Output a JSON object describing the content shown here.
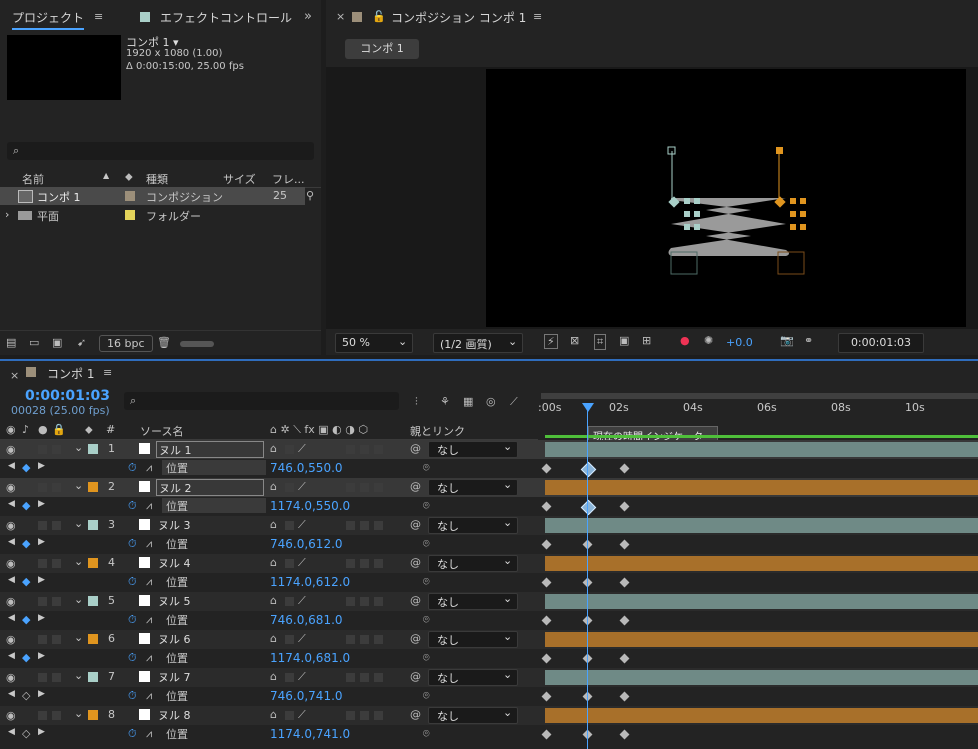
{
  "project_panel": {
    "tab_project": "プロジェクト",
    "tab_effect": "エフェクトコントロール",
    "comp_name": "コンポ 1 ▾",
    "comp_size": "1920 x 1080 (1.00)",
    "comp_duration": "Δ 0:00:15:00, 25.00 fps",
    "search_placeholder": "",
    "columns": [
      "名前",
      "種類",
      "サイズ",
      "フレ..."
    ],
    "items": [
      {
        "name": "コンポ 1",
        "type": "コンポジション",
        "size": "",
        "frames": "25",
        "color": "#9c8f7a"
      },
      {
        "name": "平面",
        "type": "フォルダー",
        "size": "",
        "frames": "",
        "color": "#e3d35a"
      }
    ],
    "bpc": "16 bpc"
  },
  "comp_panel": {
    "title": "コンポジション コンポ 1",
    "tab_label": "コンポ 1",
    "zoom": "50 %",
    "resolution": "(1/2 画質)",
    "exposure": "+0.0",
    "timecode": "0:00:01:03"
  },
  "timeline": {
    "title": "コンポ 1",
    "current_time": "0:00:01:03",
    "frame_info": "00028 (25.00 fps)",
    "col_source": "ソース名",
    "col_num": "#",
    "col_parent": "親とリンク",
    "ruler": [
      ":00s",
      "02s",
      "04s",
      "06s",
      "08s",
      "10s"
    ],
    "indicator_tooltip": "現在の時間インジケーター",
    "prop_name": "位置",
    "none_label": "なし",
    "layers": [
      {
        "num": "1",
        "name": "ヌル 1",
        "position": "746.0,550.0",
        "color": "#a9cfc8"
      },
      {
        "num": "2",
        "name": "ヌル 2",
        "position": "1174.0,550.0",
        "color": "#e0951f"
      },
      {
        "num": "3",
        "name": "ヌル 3",
        "position": "746.0,612.0",
        "color": "#a9cfc8"
      },
      {
        "num": "4",
        "name": "ヌル 4",
        "position": "1174.0,612.0",
        "color": "#e0951f"
      },
      {
        "num": "5",
        "name": "ヌル 5",
        "position": "746.0,681.0",
        "color": "#a9cfc8"
      },
      {
        "num": "6",
        "name": "ヌル 6",
        "position": "1174.0,681.0",
        "color": "#e0951f"
      },
      {
        "num": "7",
        "name": "ヌル 7",
        "position": "746.0,741.0",
        "color": "#a9cfc8"
      },
      {
        "num": "8",
        "name": "ヌル 8",
        "position": "1174.0,741.0",
        "color": "#e0951f"
      }
    ]
  },
  "colors": {
    "accent": "#4aa3ff",
    "teal": "#a9cfc8",
    "orange": "#e0951f"
  }
}
